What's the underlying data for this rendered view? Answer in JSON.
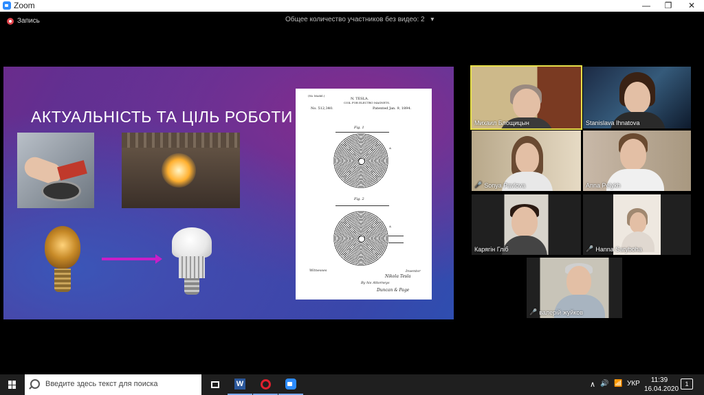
{
  "window": {
    "title": "Zoom",
    "minimize": "—",
    "restore": "❐",
    "close": "✕"
  },
  "toolbar": {
    "recording_label": "Запись",
    "nonvideo_count": "Общее количество участников без видео: 2",
    "nonvideo_caret": "▾"
  },
  "slide": {
    "title": "АКТУАЛЬНІСТЬ ТА ЦІЛЬ РОБОТИ",
    "patent": {
      "model_note": "(No Model.)",
      "inventor": "N. TESLA.",
      "subject": "COIL FOR ELECTRO MAGNETS.",
      "number": "No. 512,340.",
      "patented": "Patented Jan. 9, 1894.",
      "fig1": "Fig. 1",
      "fig2": "Fig. 2",
      "mark_a": "A",
      "witnesses": "Witnesses",
      "inventor_label": "Inventor",
      "signature": "Nikola Tesla",
      "attorneys": "By his Attorneys",
      "attorney_names": "Duncan & Page"
    }
  },
  "participants": [
    {
      "name": "Михаил Блощицын",
      "muted": false,
      "active": true
    },
    {
      "name": "Stanislava Ihnatova",
      "muted": false,
      "active": false
    },
    {
      "name": "Sonya Pavlova",
      "muted": true,
      "active": false
    },
    {
      "name": "Anna Pelykh",
      "muted": false,
      "active": false
    },
    {
      "name": "Карягін Гліб",
      "muted": false,
      "active": false
    },
    {
      "name": "Hanna Saryboha",
      "muted": true,
      "active": false
    },
    {
      "name": "валерій жуйков",
      "muted": true,
      "active": false
    }
  ],
  "taskbar": {
    "search_placeholder": "Введите здесь текст для поиска",
    "word_letter": "W",
    "tray_chevron": "∧",
    "volume": "🔊",
    "network": "📶",
    "language": "УКР",
    "time": "11:39",
    "date": "16.04.2020",
    "notifications_count": "1"
  },
  "colors": {
    "active_speaker_border": "#e8e04a",
    "recording": "#e2444b",
    "muted_mic": "#ff4040"
  }
}
